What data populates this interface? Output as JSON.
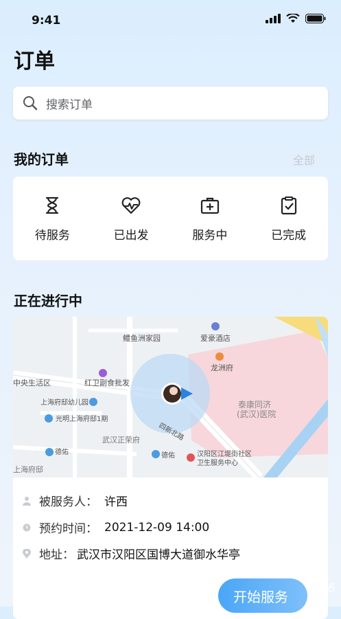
{
  "status_bar": {
    "time": "9:41"
  },
  "page_title": "订单",
  "search": {
    "placeholder": "搜索订单"
  },
  "my_orders": {
    "title": "我的订单",
    "see_all": "全部",
    "items": [
      {
        "label": "待服务",
        "icon": "hourglass-icon"
      },
      {
        "label": "已出发",
        "icon": "heartbeat-icon"
      },
      {
        "label": "服务中",
        "icon": "medical-kit-icon"
      },
      {
        "label": "已完成",
        "icon": "clipboard-check-icon"
      }
    ]
  },
  "in_progress": {
    "title": "正在进行中",
    "map_labels": {
      "poi_1": "鳢鱼洲家园",
      "poi_2": "爱豪酒店",
      "poi_3": "龙洲府",
      "poi_4": "中央生活区",
      "poi_5": "红卫副食批发",
      "poi_6": "上海府邸幼儿园",
      "poi_7": "光明上海府邸1期",
      "poi_8": "武汉正荣府",
      "poi_9": "德佑",
      "poi_10": "德佑",
      "poi_11": "汉阳区江堤街社区",
      "poi_12": "卫生服务中心",
      "poi_13": "泰康同济",
      "poi_14": "(武汉)医院",
      "poi_15": "四新北路",
      "poi_16": "上海府邸"
    },
    "served_person_label": "被服务人：",
    "served_person": "许西",
    "appointment_label": "预约时间：",
    "appointment_time": "2021-12-09 14:00",
    "address_label": "地址：",
    "address": "武汉市汉阳区国博大道御水华亭",
    "start_button": "开始服务"
  },
  "watermark": "pc6"
}
